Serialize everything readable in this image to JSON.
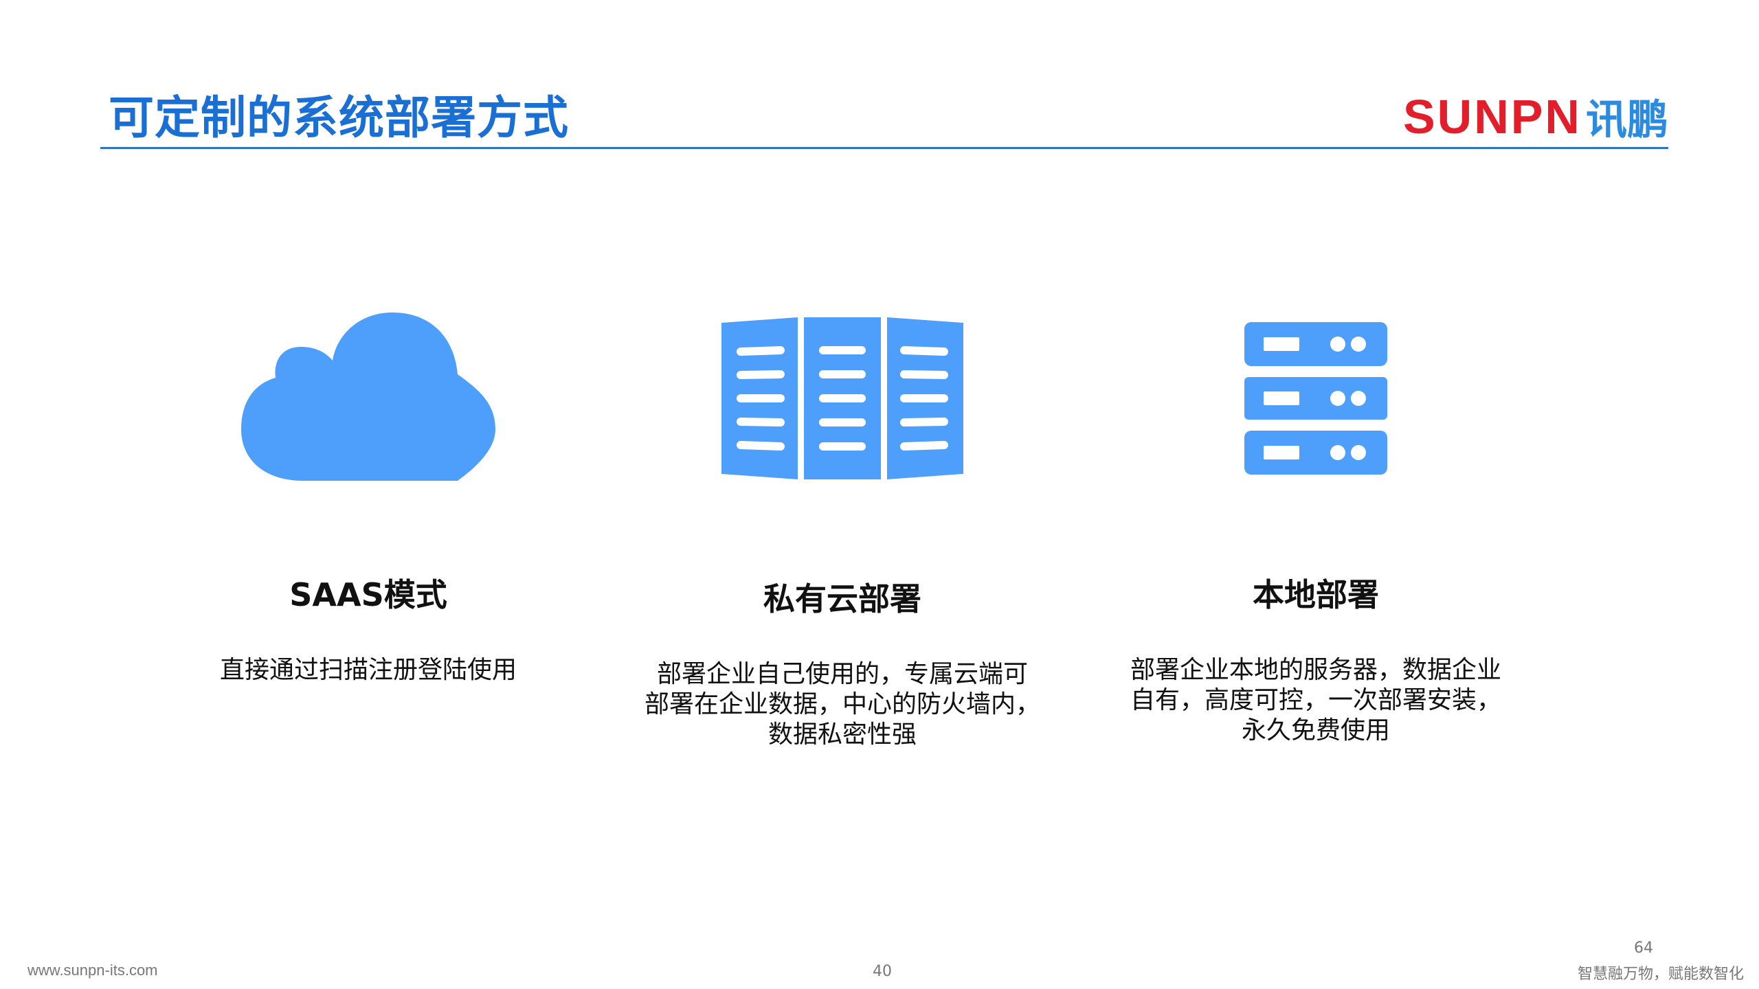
{
  "header": {
    "title": "可定制的系统部署方式",
    "logo_latin": "SUNPN",
    "logo_cjk": "讯鹏"
  },
  "columns": [
    {
      "icon": "cloud-icon",
      "heading": "SAAS模式",
      "lines": [
        "直接通过扫描注册登陆使用"
      ]
    },
    {
      "icon": "private-cloud-rack-icon",
      "heading": "私有云部署",
      "lines": [
        "部署企业自己使用的，专属云端可",
        "部署在企业数据，中心的防火墙内，",
        "数据私密性强"
      ]
    },
    {
      "icon": "server-icon",
      "heading": "本地部署",
      "lines": [
        "部署企业本地的服务器，数据企业",
        "自有，高度可控，一次部署安装，",
        "永久免费使用"
      ]
    }
  ],
  "footer": {
    "url": "www.sunpn-its.com",
    "page": "40",
    "number": "64",
    "slogan": "智慧融万物，赋能数智化"
  },
  "colors": {
    "title": "#1a6fd4",
    "icon": "#4e9ffb",
    "logo_latin": "#e21e2b",
    "logo_cjk": "#2b8be0",
    "rule": "#2e75c8"
  }
}
